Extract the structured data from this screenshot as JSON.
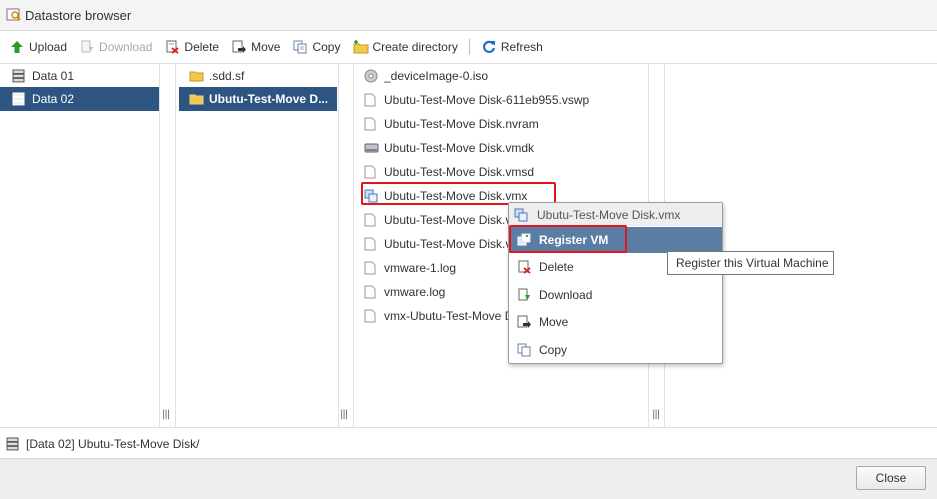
{
  "window": {
    "title": "Datastore browser"
  },
  "toolbar": {
    "upload": "Upload",
    "download": "Download",
    "delete": "Delete",
    "move": "Move",
    "copy": "Copy",
    "create_directory": "Create directory",
    "refresh": "Refresh"
  },
  "datastores": [
    {
      "label": "Data 01",
      "selected": false
    },
    {
      "label": "Data 02",
      "selected": true
    }
  ],
  "folders": [
    {
      "label": ".sdd.sf",
      "selected": false
    },
    {
      "label": "Ubutu-Test-Move D...",
      "selected": true
    }
  ],
  "files": [
    {
      "label": "_deviceImage-0.iso",
      "icon": "disc-icon"
    },
    {
      "label": "Ubutu-Test-Move Disk-611eb955.vswp",
      "icon": "file-icon"
    },
    {
      "label": "Ubutu-Test-Move Disk.nvram",
      "icon": "file-icon"
    },
    {
      "label": "Ubutu-Test-Move Disk.vmdk",
      "icon": "hard-disk-icon"
    },
    {
      "label": "Ubutu-Test-Move Disk.vmsd",
      "icon": "file-icon"
    },
    {
      "label": "Ubutu-Test-Move Disk.vmx",
      "icon": "vm-config-icon"
    },
    {
      "label": "Ubutu-Test-Move Disk.v",
      "icon": "file-icon"
    },
    {
      "label": "Ubutu-Test-Move Disk.v",
      "icon": "file-icon"
    },
    {
      "label": "vmware-1.log",
      "icon": "file-icon"
    },
    {
      "label": "vmware.log",
      "icon": "file-icon"
    },
    {
      "label": "vmx-Ubutu-Test-Move D",
      "icon": "file-icon"
    }
  ],
  "context_menu": {
    "header": "Ubutu-Test-Move Disk.vmx",
    "items": [
      {
        "label": "Register VM",
        "icon": "register-vm-icon"
      },
      {
        "label": "Delete",
        "icon": "delete-icon"
      },
      {
        "label": "Download",
        "icon": "download-icon"
      },
      {
        "label": "Move",
        "icon": "move-icon"
      },
      {
        "label": "Copy",
        "icon": "copy-icon"
      }
    ]
  },
  "tooltip": "Register this Virtual Machine",
  "status": {
    "path": "[Data 02] Ubutu-Test-Move Disk/"
  },
  "footer": {
    "close": "Close"
  },
  "colors": {
    "selection": "#2e5582",
    "menu_active": "#5b7ca3",
    "highlight_border": "#e2151a",
    "upload_green": "#2e9a2e",
    "refresh_blue": "#1f6fc4",
    "folder_yellow": "#f2c94c"
  },
  "grips": {
    "col1": "|||",
    "col2": "|||",
    "col3": "|||"
  }
}
